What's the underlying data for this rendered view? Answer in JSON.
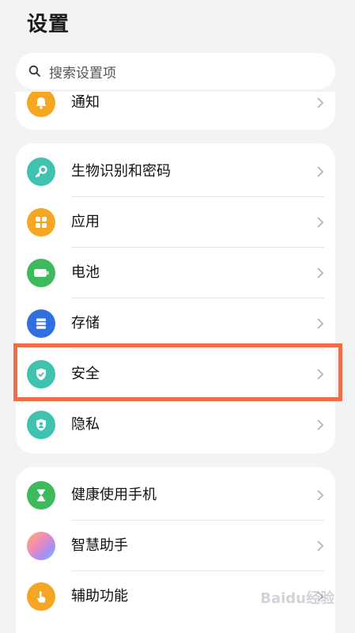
{
  "header": {
    "title": "设置"
  },
  "search": {
    "placeholder": "搜索设置项"
  },
  "top_group": {
    "items": [
      {
        "label": "通知",
        "icon": "bell-icon",
        "color": "#f5a623"
      }
    ]
  },
  "main_group": {
    "items": [
      {
        "label": "生物识别和密码",
        "icon": "key-icon",
        "color": "#3fc3b0"
      },
      {
        "label": "应用",
        "icon": "apps-grid-icon",
        "color": "#f5a623"
      },
      {
        "label": "电池",
        "icon": "battery-icon",
        "color": "#3dbb5c"
      },
      {
        "label": "存储",
        "icon": "storage-icon",
        "color": "#2f6fe0"
      },
      {
        "label": "安全",
        "icon": "shield-check-icon",
        "color": "#3fc3b0"
      },
      {
        "label": "隐私",
        "icon": "privacy-shield-icon",
        "color": "#3fc3b0"
      }
    ]
  },
  "bottom_group": {
    "items": [
      {
        "label": "健康使用手机",
        "icon": "hourglass-icon",
        "color": "#3dbb5c"
      },
      {
        "label": "智慧助手",
        "icon": "assistant-icon",
        "color": "#b68fe8"
      },
      {
        "label": "辅助功能",
        "icon": "hand-icon",
        "color": "#f5a623"
      }
    ]
  },
  "highlight_color": "#ee6e48",
  "watermark": {
    "text": "Baidu经验"
  }
}
